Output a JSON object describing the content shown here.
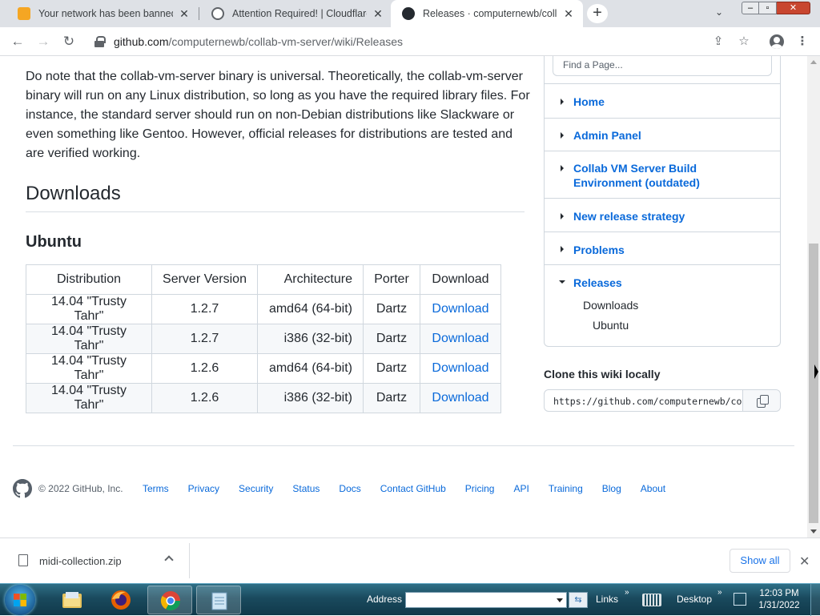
{
  "browser": {
    "tabs": [
      {
        "title": "Your network has been banned f",
        "favicon_color": "#f5a623"
      },
      {
        "title": "Attention Required! | Cloudflare",
        "favicon_color": "#5f6368"
      },
      {
        "title": "Releases · computernewb/collab",
        "favicon_color": "#24292f"
      }
    ],
    "new_tab_glyph": "+",
    "url_host": "github.com",
    "url_path": "/computernewb/collab-vm-server/wiki/Releases"
  },
  "content": {
    "intro": "Do note that the collab-vm-server binary is universal. Theoretically, the collab-vm-server binary will run on any Linux distribution, so long as you have the required library files. For instance, the standard server should run on non-Debian distributions like Slackware or even something like Gentoo. However, official releases for distributions are tested and are verified working.",
    "downloads_heading": "Downloads",
    "ubuntu_heading": "Ubuntu",
    "table": {
      "headers": [
        "Distribution",
        "Server Version",
        "Architecture",
        "Porter",
        "Download"
      ],
      "rows": [
        [
          "14.04 \"Trusty Tahr\"",
          "1.2.7",
          "amd64 (64-bit)",
          "Dartz",
          "Download"
        ],
        [
          "14.04 \"Trusty Tahr\"",
          "1.2.7",
          "i386 (32-bit)",
          "Dartz",
          "Download"
        ],
        [
          "14.04 \"Trusty Tahr\"",
          "1.2.6",
          "amd64 (64-bit)",
          "Dartz",
          "Download"
        ],
        [
          "14.04 \"Trusty Tahr\"",
          "1.2.6",
          "i386 (32-bit)",
          "Dartz",
          "Download"
        ]
      ]
    }
  },
  "sidebar": {
    "find_placeholder": "Find a Page...",
    "items": [
      {
        "label": "Home"
      },
      {
        "label": "Admin Panel"
      },
      {
        "label": "Collab VM Server Build Environment (outdated)"
      },
      {
        "label": "New release strategy"
      },
      {
        "label": "Problems"
      },
      {
        "label": "Releases"
      }
    ],
    "sub_items": [
      "Downloads",
      "Ubuntu"
    ],
    "clone_heading": "Clone this wiki locally",
    "clone_url": "https://github.com/computernewb/co"
  },
  "footer": {
    "copyright": "© 2022 GitHub, Inc.",
    "links": [
      "Terms",
      "Privacy",
      "Security",
      "Status",
      "Docs",
      "Contact GitHub",
      "Pricing",
      "API",
      "Training",
      "Blog",
      "About"
    ]
  },
  "download_shelf": {
    "file_name": "midi-collection.zip",
    "show_all": "Show all"
  },
  "taskbar": {
    "address_label": "Address",
    "links_label": "Links",
    "desktop_label": "Desktop",
    "time": "12:03 PM",
    "date": "1/31/2022"
  },
  "colors": {
    "link": "#0969da",
    "text": "#24292f",
    "tab_strip": "#dee1e6"
  }
}
